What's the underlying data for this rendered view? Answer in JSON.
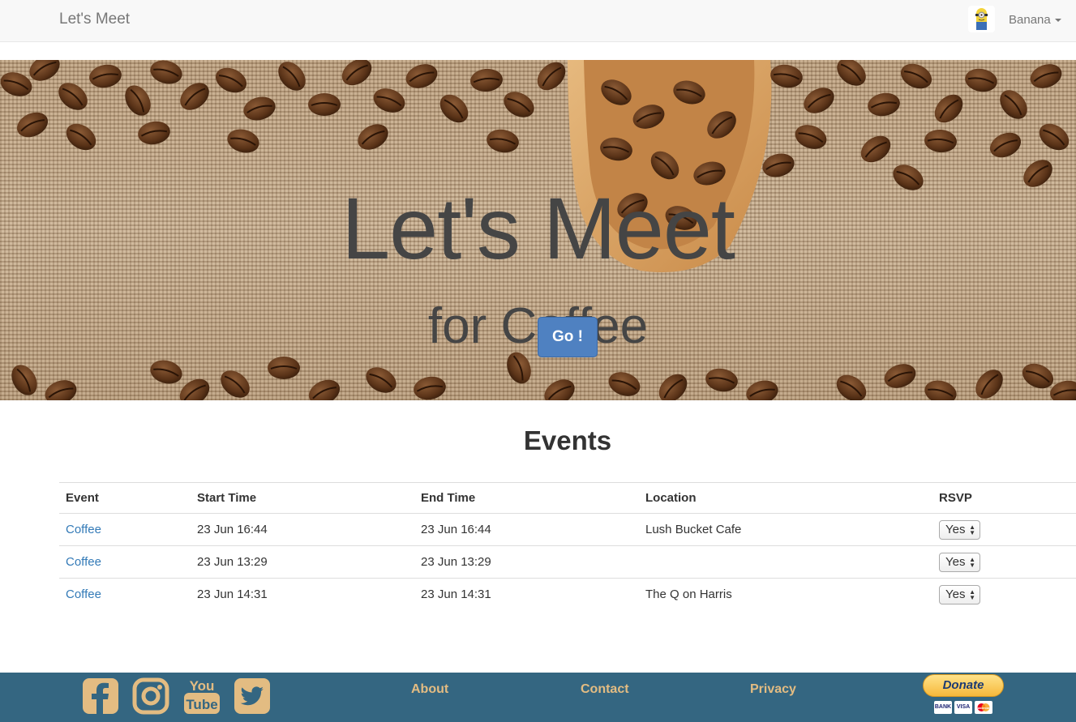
{
  "navbar": {
    "brand": "Let's Meet",
    "user_name": "Banana",
    "avatar_icon": "minion-avatar-icon"
  },
  "hero": {
    "title": "Let's Meet",
    "subtitle": "for Coffee",
    "go_label": "Go !"
  },
  "events": {
    "heading": "Events",
    "columns": [
      "Event",
      "Start Time",
      "End Time",
      "Location",
      "RSVP"
    ],
    "rows": [
      {
        "event": "Coffee",
        "start": "23 Jun 16:44",
        "end": "23 Jun 16:44",
        "location": "Lush Bucket Cafe",
        "rsvp": "Yes"
      },
      {
        "event": "Coffee",
        "start": "23 Jun 13:29",
        "end": "23 Jun 13:29",
        "location": "",
        "rsvp": "Yes"
      },
      {
        "event": "Coffee",
        "start": "23 Jun 14:31",
        "end": "23 Jun 14:31",
        "location": "The Q on Harris",
        "rsvp": "Yes"
      }
    ]
  },
  "footer": {
    "social_icons": [
      "facebook-icon",
      "instagram-icon",
      "youtube-icon",
      "twitter-icon"
    ],
    "youtube_text_top": "You",
    "youtube_text_bottom": "Tube",
    "links": [
      "About",
      "Contact",
      "Privacy"
    ],
    "donate_label": "Donate",
    "payment_cards": [
      "BANK",
      "VISA",
      "mastercard"
    ]
  },
  "colors": {
    "navbar_bg": "#f8f8f8",
    "accent_button": "#4f81c1",
    "link": "#337ab7",
    "footer_bg": "#346681",
    "footer_text": "#e3bc82"
  }
}
